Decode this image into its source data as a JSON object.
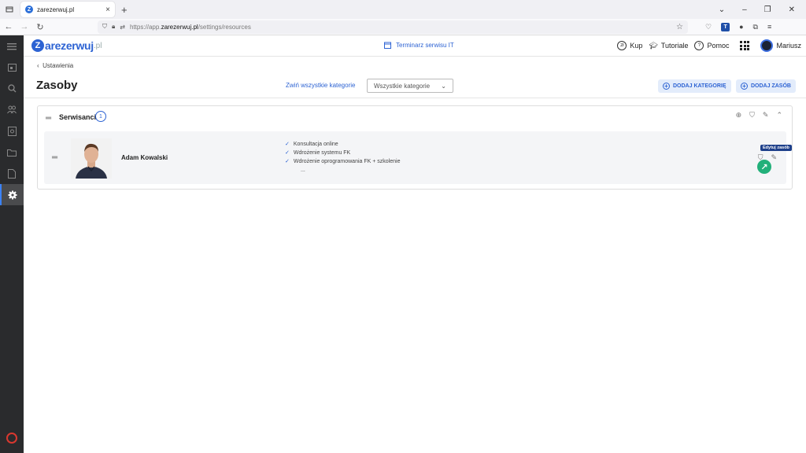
{
  "browser": {
    "tab_title": "zarezerwuj.pl",
    "favicon_letter": "Z",
    "url_prefix": "https://app.",
    "url_domain": "zarezerwuj.pl",
    "url_path": "/settings/resources",
    "new_tab": "+",
    "close_tab": "×"
  },
  "app": {
    "logo_letter": "Z",
    "logo_text": "arezerwuj",
    "logo_tld": ".pl",
    "schedule_link": "Terminarz serwisu IT",
    "header_items": {
      "buy": "Kup",
      "tutorials": "Tutoriale",
      "help": "Pomoc",
      "user": "Mariusz"
    },
    "buy_icon_text": "zł",
    "help_icon_text": "?"
  },
  "page": {
    "back_label": "Ustawienia",
    "title": "Zasoby",
    "collapse_all": "Zwiń wszystkie kategorie",
    "category_select": "Wszystkie kategorie",
    "add_category": "DODAJ KATEGORIĘ",
    "add_resource": "DODAJ ZASÓB"
  },
  "category": {
    "name": "Serwisanci",
    "count": "1"
  },
  "resource": {
    "name": "Adam Kowalski",
    "services": [
      "Konsultacja online",
      "Wdrożenie systemu FK",
      "Wdrożenie oprogramowania FK + szkolenie"
    ],
    "more": "..."
  },
  "tooltip": "Edytuj zasób",
  "colors": {
    "accent": "#2d63d3",
    "rail": "#2a2b2d",
    "cursor": "#22b07a"
  }
}
